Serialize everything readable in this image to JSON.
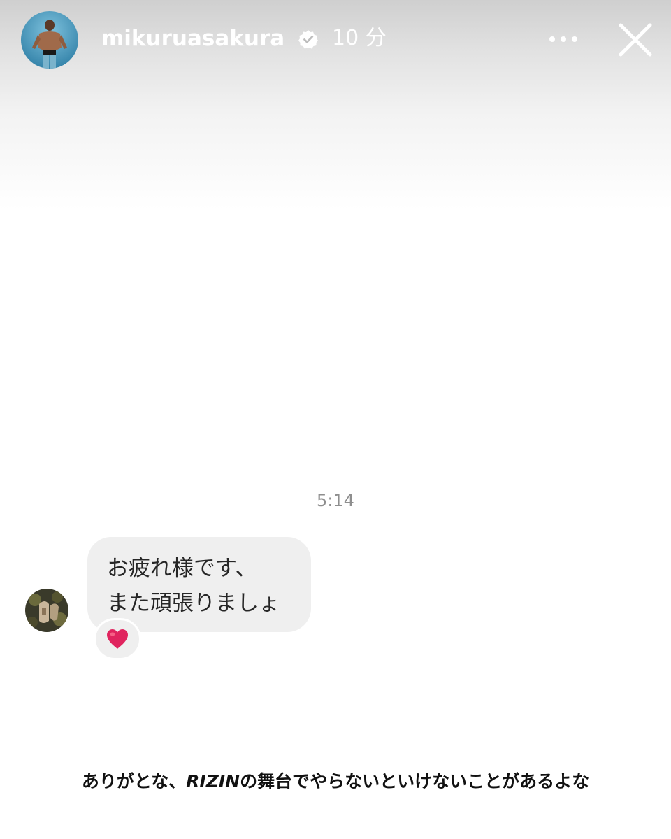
{
  "header": {
    "username": "mikuruasakura",
    "time_ago": "10 分",
    "avatar_icon": "profile-photo",
    "verified_icon": "verified-badge-icon",
    "more_icon": "more-options-icon",
    "close_icon": "close-icon"
  },
  "chat": {
    "timestamp": "5:14",
    "message_lines": [
      "お疲れ様です、",
      "また頑張りましょ"
    ],
    "reaction": "❤️",
    "sender_avatar_icon": "sender-avatar"
  },
  "caption": {
    "before": "ありがとな、",
    "brand": "RIZIN",
    "after": "の舞台でやらないといけないことがあるよな"
  },
  "colors": {
    "bubble": "#efefef",
    "timestamp": "#8e8e8e",
    "reaction_heart": "#e0245e",
    "header_text": "#ffffff"
  }
}
